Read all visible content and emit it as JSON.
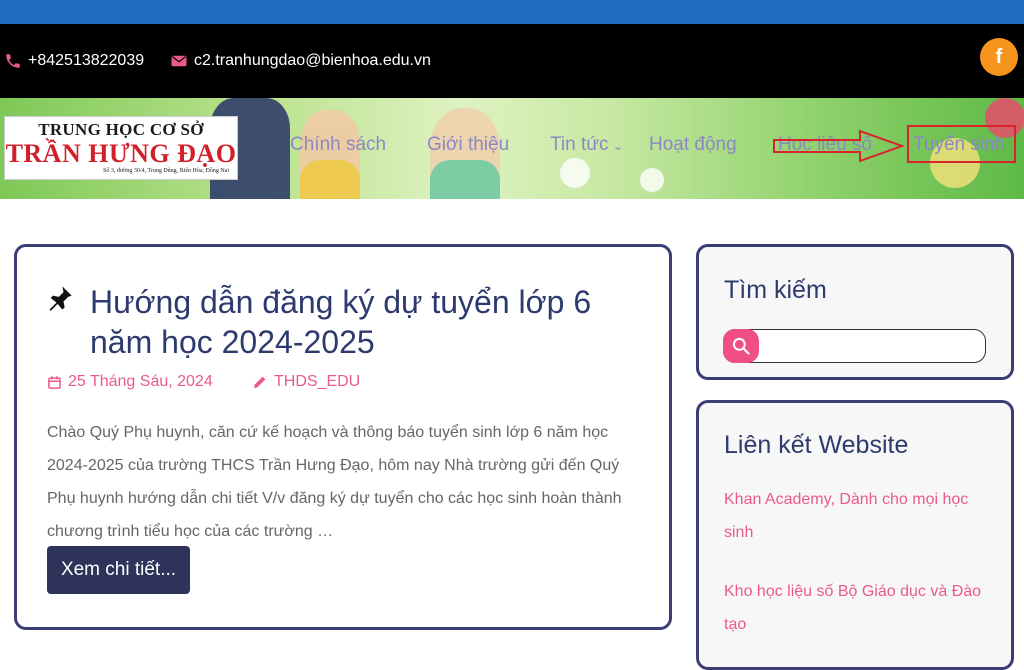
{
  "topbar": {
    "phone": "+842513822039",
    "email": "c2.tranhungdao@bienhoa.edu.vn",
    "social_icon": "facebook-icon",
    "social_glyph": "f"
  },
  "logo": {
    "line1": "TRUNG HỌC CƠ SỞ",
    "line2": "TRẦN HƯNG ĐẠO",
    "line3": "Số 3, đường 30/4, Trung Dũng, Biên Hòa, Đồng Nai"
  },
  "nav": {
    "items": [
      "Chính sách",
      "Giới thiệu",
      "Tin tức",
      "Hoạt động",
      "Học liệu số",
      "Tuyển sinh"
    ],
    "dropdown_glyph": "⌄"
  },
  "post": {
    "title": "Hướng dẫn đăng ký dự tuyển lớp 6 năm học 2024-2025",
    "date": "25 Tháng Sáu, 2024",
    "author": "THDS_EDU",
    "excerpt": "Chào Quý Phụ huynh, căn cứ kế hoạch và thông báo tuyển sinh lớp 6 năm học 2024-2025 của trường THCS Trần Hưng Đạo, hôm nay Nhà trường gửi đến Quý Phụ huynh hướng dẫn chi tiết V/v đăng ký dự tuyển cho các học sinh hoàn thành chương trình tiểu học của các trường …",
    "read_more": "Xem chi tiết..."
  },
  "sidebar": {
    "search_title": "Tìm kiếm",
    "search_value": "",
    "links_title": "Liên kết Website",
    "links": [
      "Khan Academy, Dành cho mọi học sinh",
      "Kho học liệu số Bộ Giáo dục và Đào tạo"
    ]
  },
  "colors": {
    "accent": "#ea5a8b",
    "navy": "#2d3a6e",
    "highlight": "#d9232e",
    "facebook": "#f7941d"
  }
}
